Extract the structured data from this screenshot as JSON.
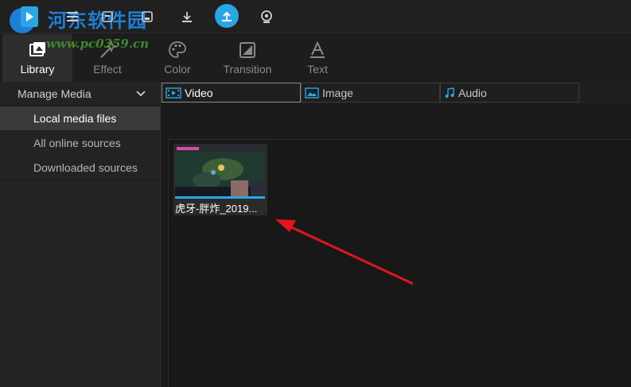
{
  "watermark": {
    "text": "河东软件园",
    "url": "www.pc0359.cn"
  },
  "toolbar": {
    "icons": [
      "menu-icon",
      "open-project-icon",
      "save-project-icon",
      "import-icon",
      "export-icon",
      "record-icon"
    ]
  },
  "tabs": [
    {
      "label": "Library",
      "icon": "library-icon",
      "active": true
    },
    {
      "label": "Effect",
      "icon": "effect-icon",
      "active": false
    },
    {
      "label": "Color",
      "icon": "color-palette-icon",
      "active": false
    },
    {
      "label": "Transition",
      "icon": "transition-icon",
      "active": false
    },
    {
      "label": "Text",
      "icon": "text-icon",
      "active": false
    }
  ],
  "sidebar": {
    "header": "Manage Media",
    "items": [
      {
        "label": "Local media files",
        "active": true
      },
      {
        "label": "All online sources",
        "active": false
      },
      {
        "label": "Downloaded sources",
        "active": false
      }
    ]
  },
  "media_tabs": [
    {
      "label": "Video",
      "icon": "film-icon",
      "active": true
    },
    {
      "label": "Image",
      "icon": "image-icon",
      "active": false
    },
    {
      "label": "Audio",
      "icon": "music-note-icon",
      "active": false
    }
  ],
  "library": {
    "clips": [
      {
        "name": "虎牙-胖炸_2019..."
      }
    ]
  },
  "colors": {
    "accent": "#2aa6e6",
    "annotation_arrow": "#e0161b"
  }
}
